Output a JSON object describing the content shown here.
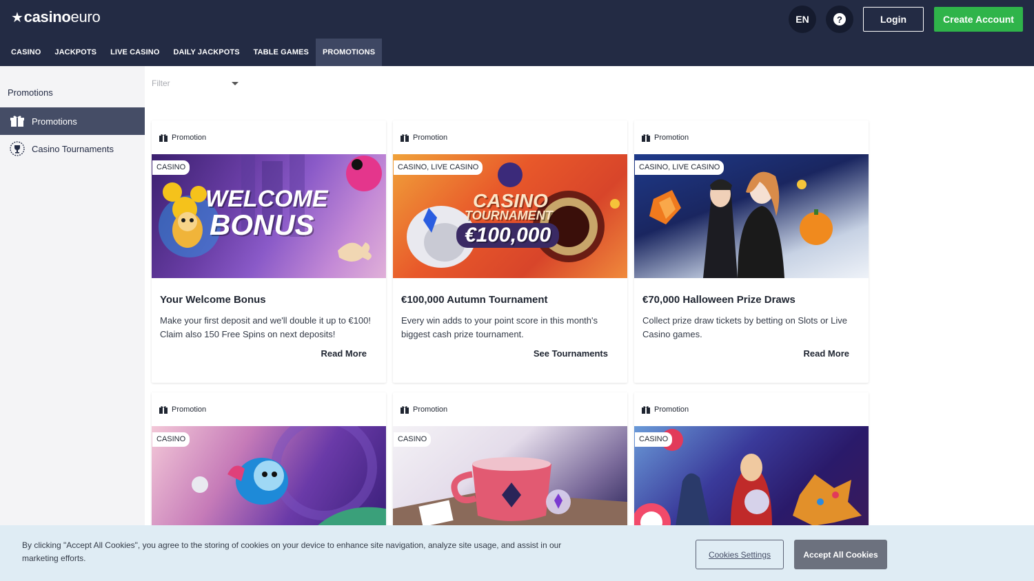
{
  "header": {
    "logo_bold": "casino",
    "logo_light": "euro",
    "lang": "EN",
    "help_glyph": "?",
    "login_label": "Login",
    "create_label": "Create Account"
  },
  "nav": {
    "items": [
      "CASINO",
      "JACKPOTS",
      "LIVE CASINO",
      "DAILY JACKPOTS",
      "TABLE GAMES",
      "PROMOTIONS"
    ],
    "active": "PROMOTIONS"
  },
  "sidebar": {
    "title": "Promotions",
    "items": [
      {
        "label": "Promotions",
        "icon": "gift-icon",
        "active": true
      },
      {
        "label": "Casino Tournaments",
        "icon": "trophy-icon",
        "active": false
      }
    ]
  },
  "filter": {
    "placeholder": "Filter"
  },
  "cards": [
    {
      "type": "Promotion",
      "tag": "CASINO",
      "img_line1": "WELCOME",
      "img_line2": "BONUS",
      "title": "Your Welcome Bonus",
      "desc": "Make your first deposit and we'll double it up to €100! Claim also 150 Free Spins on next deposits!",
      "link": "Read More"
    },
    {
      "type": "Promotion",
      "tag": "CASINO, LIVE CASINO",
      "img_line1": "CASINO",
      "img_line2": "TOURNAMENT",
      "img_line3": "€100,000",
      "title": "€100,000 Autumn Tournament",
      "desc": "Every win adds to your point score in this month's biggest cash prize tournament.",
      "link": "See Tournaments"
    },
    {
      "type": "Promotion",
      "tag": "CASINO, LIVE CASINO",
      "title": "€70,000 Halloween Prize Draws",
      "desc": "Collect prize draw tickets by betting on Slots or Live Casino games.",
      "link": "Read More"
    },
    {
      "type": "Promotion",
      "tag": "CASINO"
    },
    {
      "type": "Promotion",
      "tag": "CASINO"
    },
    {
      "type": "Promotion",
      "tag": "CASINO"
    }
  ],
  "cookie": {
    "text": "By clicking \"Accept All Cookies\", you agree to the storing of cookies on your device to enhance site navigation, analyze site usage, and assist in our marketing efforts.",
    "settings_label": "Cookies Settings",
    "accept_label": "Accept All Cookies"
  },
  "colors": {
    "header_bg": "#232b44",
    "nav_active_bg": "#3e4763",
    "create_green": "#2fb44a",
    "sidebar_bg": "#f4f4f6",
    "sidebar_active_bg": "#454d66",
    "cookie_bg": "#dfecf4",
    "accept_bg": "#6c717e"
  }
}
